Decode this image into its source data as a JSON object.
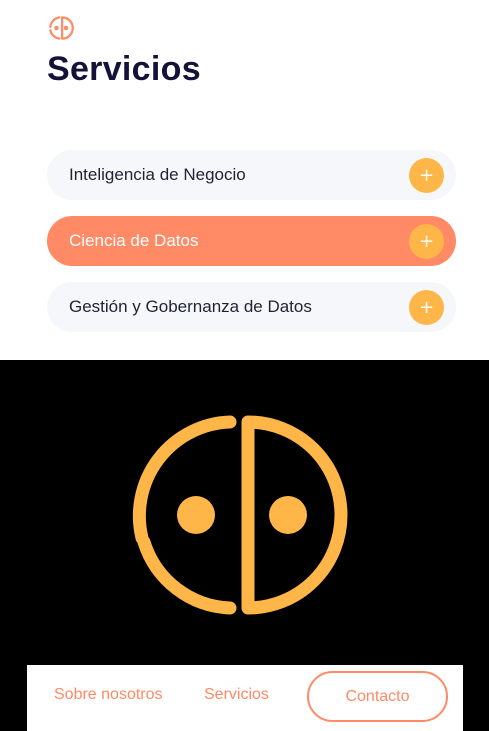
{
  "header": {
    "title": "Servicios",
    "logo_icon": "face-circle-logo-icon"
  },
  "services": [
    {
      "label": "Inteligencia de Negocio",
      "expand": "+"
    },
    {
      "label": "Ciencia de Datos",
      "expand": "+"
    },
    {
      "label": "Gestión y Gobernanza de Datos",
      "expand": "+"
    }
  ],
  "nav": {
    "about": "Sobre nosotros",
    "services": "Servicios",
    "contact": "Contacto"
  },
  "colors": {
    "accent": "#ff8a65",
    "logo": "#ffb648",
    "title": "#15123a",
    "card": "#f5f7fa"
  }
}
